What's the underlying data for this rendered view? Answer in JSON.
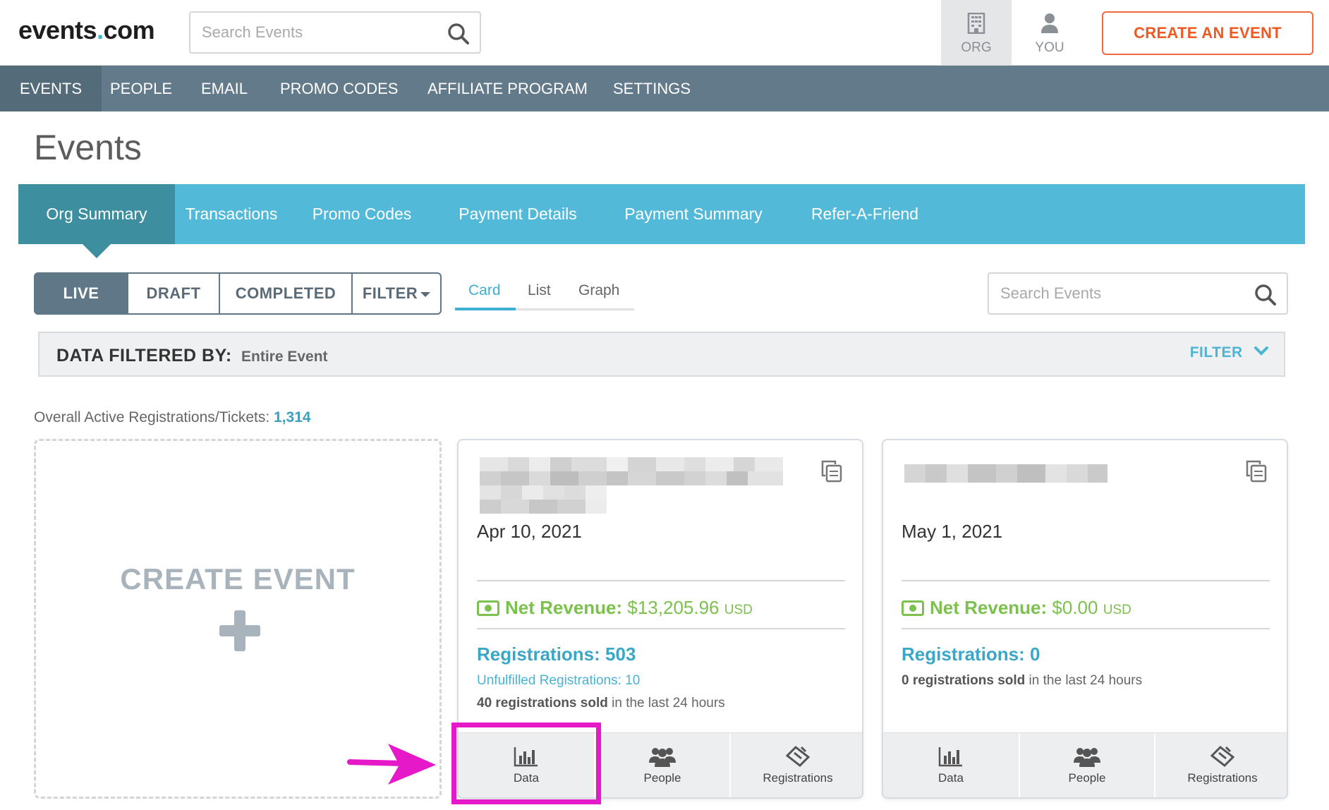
{
  "header": {
    "logo_main": "events",
    "logo_dot": ".",
    "logo_tld": "com",
    "search_placeholder": "Search Events",
    "org_label": "ORG",
    "you_label": "YOU",
    "create_button": "CREATE AN EVENT"
  },
  "nav": {
    "items": [
      {
        "label": "EVENTS",
        "active": true
      },
      {
        "label": "PEOPLE"
      },
      {
        "label": "EMAIL"
      },
      {
        "label": "PROMO CODES"
      },
      {
        "label": "AFFILIATE PROGRAM"
      },
      {
        "label": "SETTINGS"
      }
    ]
  },
  "page_title": "Events",
  "subtabs": [
    {
      "label": "Org Summary",
      "active": true
    },
    {
      "label": "Transactions"
    },
    {
      "label": "Promo Codes"
    },
    {
      "label": "Payment Details"
    },
    {
      "label": "Payment Summary"
    },
    {
      "label": "Refer-A-Friend"
    }
  ],
  "status_filters": [
    {
      "label": "LIVE",
      "active": true
    },
    {
      "label": "DRAFT"
    },
    {
      "label": "COMPLETED"
    },
    {
      "label": "FILTER"
    }
  ],
  "views": [
    {
      "label": "Card",
      "active": true
    },
    {
      "label": "List"
    },
    {
      "label": "Graph"
    }
  ],
  "right_search_placeholder": "Search Events",
  "filter_bar": {
    "label": "DATA FILTERED BY:",
    "value": "Entire Event",
    "link": "FILTER"
  },
  "overall": {
    "label": "Overall Active Registrations/Tickets:",
    "count": "1,314"
  },
  "create_card": {
    "label": "CREATE EVENT"
  },
  "events": [
    {
      "date": "Apr 10, 2021",
      "net_revenue_label": "Net Revenue:",
      "net_revenue_value": "$13,205.96",
      "currency": "USD",
      "registrations": "Registrations: 503",
      "unfulfilled": "Unfulfilled Registrations: 10",
      "sold_bold": "40 registrations sold",
      "sold_rest": " in the last 24 hours",
      "actions": [
        "Data",
        "People",
        "Registrations"
      ]
    },
    {
      "date": "May 1, 2021",
      "net_revenue_label": "Net Revenue:",
      "net_revenue_value": "$0.00",
      "currency": "USD",
      "registrations": "Registrations: 0",
      "sold_bold": "0 registrations sold",
      "sold_rest": " in the last 24 hours",
      "actions": [
        "Data",
        "People",
        "Registrations"
      ]
    }
  ],
  "colors": {
    "brand_blue": "#53b9d9",
    "nav_slate": "#637a8a",
    "accent_orange": "#ef5a24",
    "revenue_green": "#7cc14e",
    "annotation_magenta": "#e619c8"
  },
  "icons": [
    "search-icon",
    "building-icon",
    "user-icon",
    "copy-icon",
    "money-icon",
    "bar-chart-icon",
    "people-icon",
    "ticket-icon",
    "plus-icon",
    "arrow-annotation"
  ]
}
